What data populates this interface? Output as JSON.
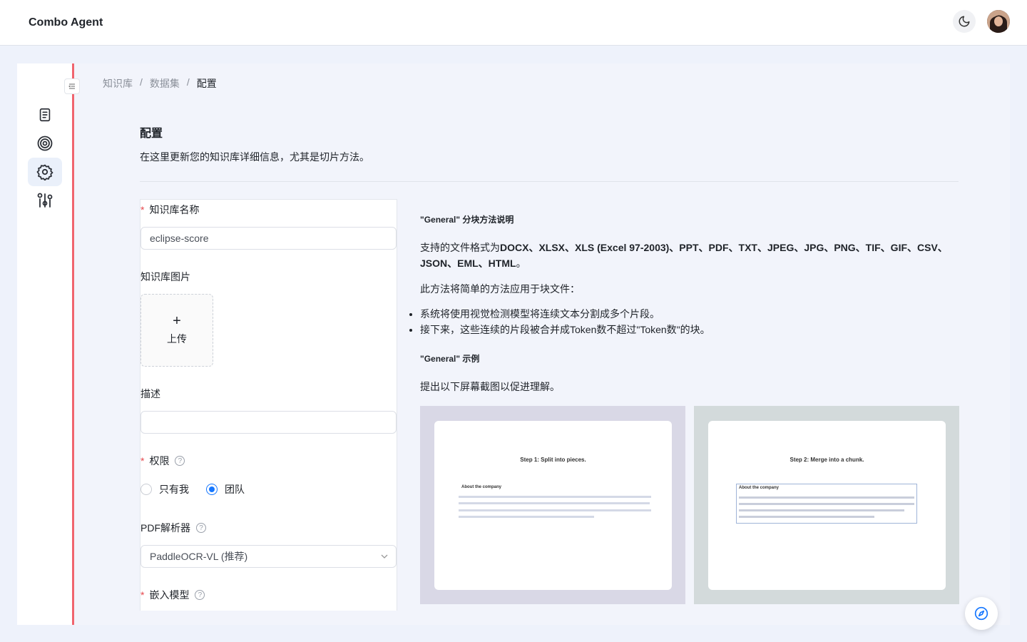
{
  "app": {
    "title": "Combo Agent"
  },
  "breadcrumb": {
    "items": [
      "知识库",
      "数据集"
    ],
    "separator": "/",
    "current": "配置"
  },
  "page": {
    "title": "配置",
    "description": "在这里更新您的知识库详细信息，尤其是切片方法。"
  },
  "form": {
    "name_label": "知识库名称",
    "name_value": "eclipse-score",
    "image_label": "知识库图片",
    "upload_plus": "+",
    "upload_label": "上传",
    "description_label": "描述",
    "description_value": "",
    "permission_label": "权限",
    "permission_options": [
      "只有我",
      "团队"
    ],
    "permission_selected": "团队",
    "pdf_parser_label": "PDF解析器",
    "pdf_parser_value": "PaddleOCR-VL (推荐)",
    "embedding_label": "嵌入模型"
  },
  "doc": {
    "method_heading": "\"General\" 分块方法说明",
    "formats_prefix": "支持的文件格式为",
    "formats_bold": "DOCX、XLSX、XLS (Excel 97-2003)、PPT、PDF、TXT、JPEG、JPG、PNG、TIF、GIF、CSV、JSON、EML、HTML",
    "formats_suffix": "。",
    "intro": "此方法将简单的方法应用于块文件：",
    "bullets": [
      "系统将使用视觉检测模型将连续文本分割成多个片段。",
      "接下来，这些连续的片段被合并成Token数不超过\"Token数\"的块。"
    ],
    "example_heading": "\"General\" 示例",
    "example_text": "提出以下屏幕截图以促进理解。",
    "screenshots": [
      {
        "step": "Step 1: Split into pieces.",
        "section": "About the company"
      },
      {
        "step": "Step 2: Merge into a chunk.",
        "section": "About the company"
      }
    ]
  },
  "icons": {
    "sidebar": [
      "document-icon",
      "target-icon",
      "settings-icon",
      "tuning-icon"
    ],
    "theme": "moon-icon",
    "fab": "compass-icon"
  },
  "colors": {
    "accent": "#1677ff",
    "sidebar_border": "#f0646e",
    "required": "#e5484d"
  }
}
